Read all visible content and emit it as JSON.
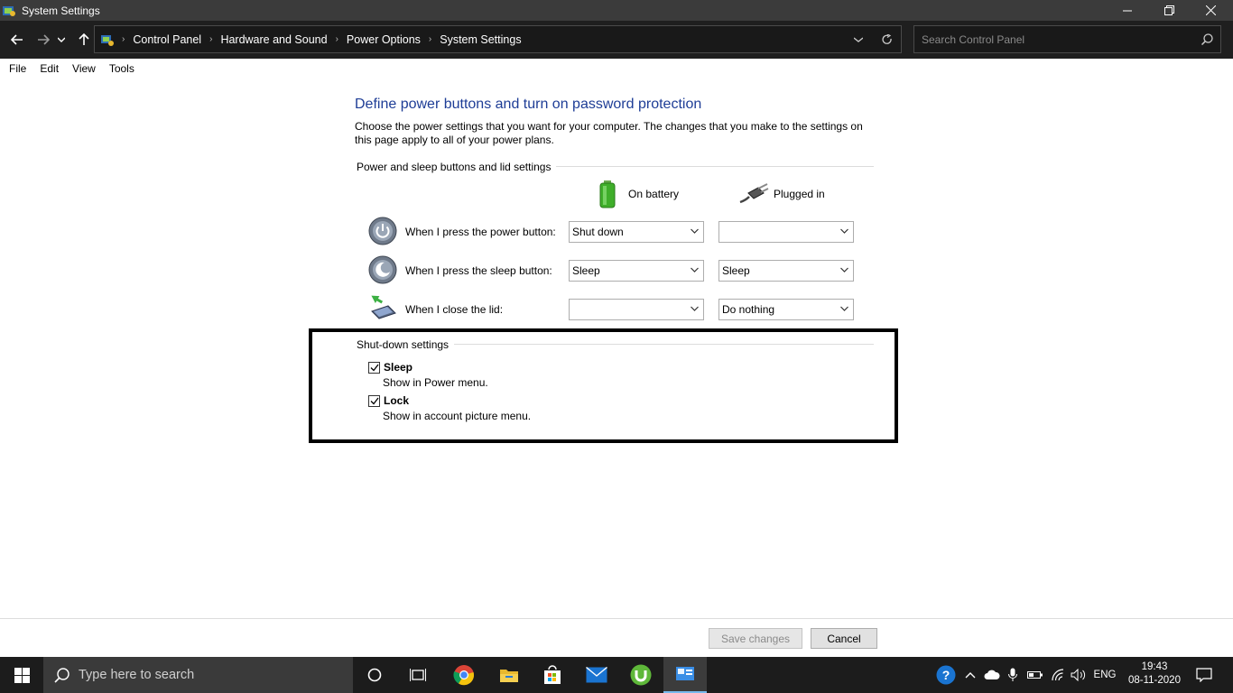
{
  "window": {
    "title": "System Settings",
    "icons": [
      "control-panel-icon",
      "minimize-icon",
      "maximize-icon",
      "close-icon"
    ]
  },
  "address_bar": {
    "breadcrumbs": [
      "Control Panel",
      "Hardware and Sound",
      "Power Options",
      "System Settings"
    ],
    "search_placeholder": "Search Control Panel"
  },
  "menu": [
    "File",
    "Edit",
    "View",
    "Tools"
  ],
  "page": {
    "heading": "Define power buttons and turn on password protection",
    "description": "Choose the power settings that you want for your computer. The changes that you make to the settings on this page apply to all of your power plans.",
    "group1_title": "Power and sleep buttons and lid settings",
    "col_battery": "On battery",
    "col_plugged": "Plugged in",
    "rows": [
      {
        "label": "When I press the power button:",
        "battery": "Shut down",
        "plugged": ""
      },
      {
        "label": "When I press the sleep button:",
        "battery": "Sleep",
        "plugged": "Sleep"
      },
      {
        "label": "When I close the lid:",
        "battery": "",
        "plugged": "Do nothing"
      }
    ],
    "group2_title": "Shut-down settings",
    "options": [
      {
        "title": "Sleep",
        "subtitle": "Show in Power menu.",
        "checked": true
      },
      {
        "title": "Lock",
        "subtitle": "Show in account picture menu.",
        "checked": true
      }
    ]
  },
  "footer": {
    "save_label": "Save changes",
    "cancel_label": "Cancel"
  },
  "taskbar": {
    "search_placeholder": "Type here to search",
    "language": "ENG",
    "time": "19:43",
    "date": "08-11-2020"
  },
  "colors": {
    "heading_blue": "#1e3d96",
    "title_bar": "#3b3b3b",
    "address_bar": "#1f1f1f",
    "taskbar": "#1c1c1c"
  }
}
